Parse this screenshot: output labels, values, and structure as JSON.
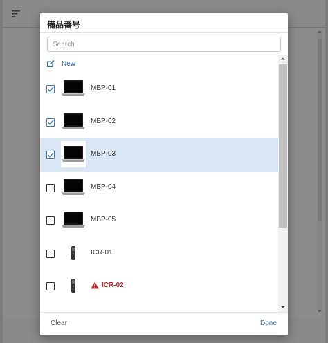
{
  "dialog": {
    "title": "備品番号",
    "search_placeholder": "Search",
    "search_value": "",
    "new_label": "New",
    "clear_label": "Clear",
    "done_label": "Done"
  },
  "items": [
    {
      "label": "MBP-01",
      "checked": true,
      "icon": "laptop-thumbnail",
      "selected": false,
      "warning": false
    },
    {
      "label": "MBP-02",
      "checked": true,
      "icon": "laptop-thumbnail",
      "selected": false,
      "warning": false
    },
    {
      "label": "MBP-03",
      "checked": true,
      "icon": "laptop-thumbnail",
      "selected": true,
      "warning": false
    },
    {
      "label": "MBP-04",
      "checked": false,
      "icon": "laptop-thumbnail",
      "selected": false,
      "warning": false
    },
    {
      "label": "MBP-05",
      "checked": false,
      "icon": "laptop-thumbnail",
      "selected": false,
      "warning": false
    },
    {
      "label": "ICR-01",
      "checked": false,
      "icon": "ic-recorder-thumbnail",
      "selected": false,
      "warning": false
    },
    {
      "label": "ICR-02",
      "checked": false,
      "icon": "ic-recorder-thumbnail",
      "selected": false,
      "warning": true
    }
  ],
  "colors": {
    "accent": "#2e6da4",
    "checkbox_checked": "#3a79bd",
    "selected_row": "#dae6f3",
    "warning": "#c62828",
    "overlay": "#7b7b7b"
  },
  "icons": {
    "filter": "filter-icon",
    "edit": "edit-icon",
    "check": "check-icon",
    "warning": "warning-icon",
    "scroll_up": "chevron-up-icon",
    "scroll_down": "chevron-down-icon"
  }
}
